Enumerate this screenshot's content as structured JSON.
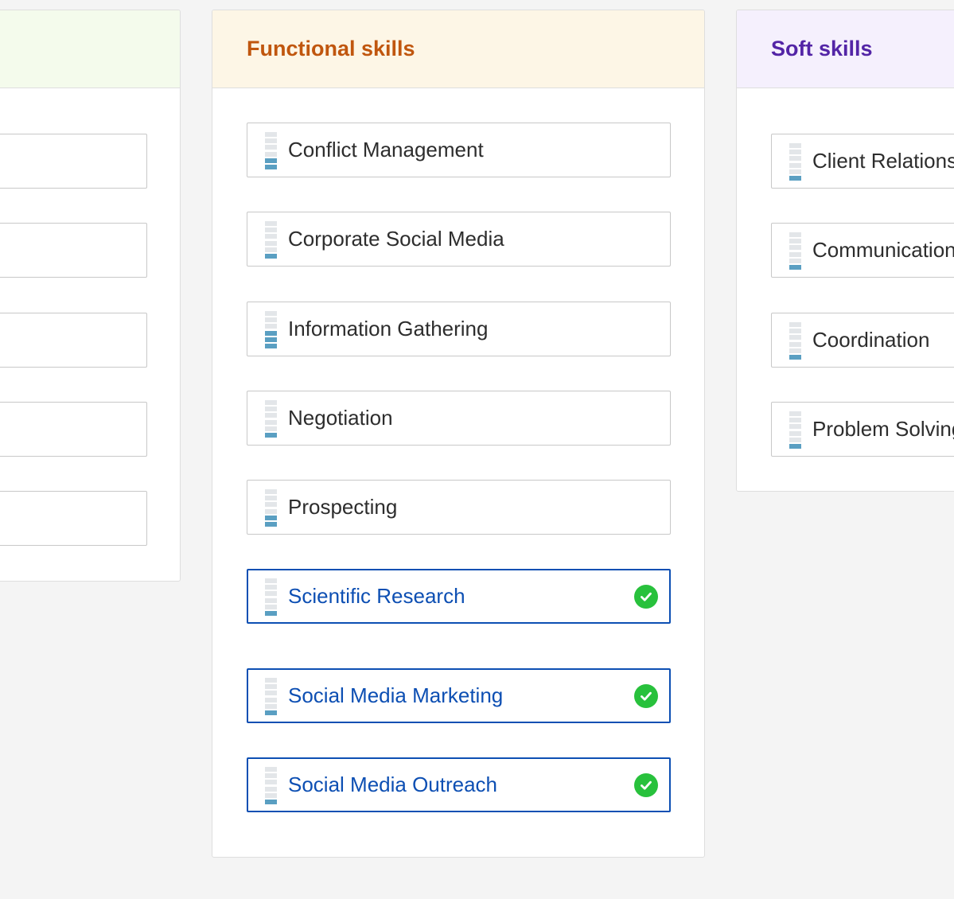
{
  "columns": {
    "left": {
      "title": "",
      "skills": [
        {
          "name": ""
        },
        {
          "name": ""
        },
        {
          "name": ""
        },
        {
          "name": ""
        },
        {
          "name": ""
        }
      ]
    },
    "functional": {
      "title": "Functional skills",
      "title_color": "#c0560e",
      "header_bg": "#fdf6e6",
      "skills": [
        {
          "name": "Conflict Management",
          "level": 2,
          "selected": false
        },
        {
          "name": "Corporate Social Media",
          "level": 1,
          "selected": false
        },
        {
          "name": "Information Gathering",
          "level": 3,
          "selected": false
        },
        {
          "name": "Negotiation",
          "level": 1,
          "selected": false
        },
        {
          "name": "Prospecting",
          "level": 2,
          "selected": false
        },
        {
          "name": "Scientific Research",
          "level": 1,
          "selected": true
        },
        {
          "name": "Social Media Marketing",
          "level": 1,
          "selected": true
        },
        {
          "name": "Social Media Outreach",
          "level": 1,
          "selected": true
        }
      ]
    },
    "soft": {
      "title": "Soft skills",
      "title_color": "#5325a6",
      "header_bg": "#f5f0fd",
      "skills": [
        {
          "name": "Client Relationship",
          "level": 1
        },
        {
          "name": "Communication",
          "level": 1
        },
        {
          "name": "Coordination",
          "level": 1
        },
        {
          "name": "Problem Solving",
          "level": 1
        }
      ]
    }
  },
  "colors": {
    "selected_accent": "#0d4fb3",
    "check_green": "#28c13c",
    "level_on": "#5a9fc2",
    "level_off": "#e3e6e9"
  },
  "icons": {
    "level": "skill-level-bars-icon",
    "selected": "checkmark-circle-icon"
  }
}
